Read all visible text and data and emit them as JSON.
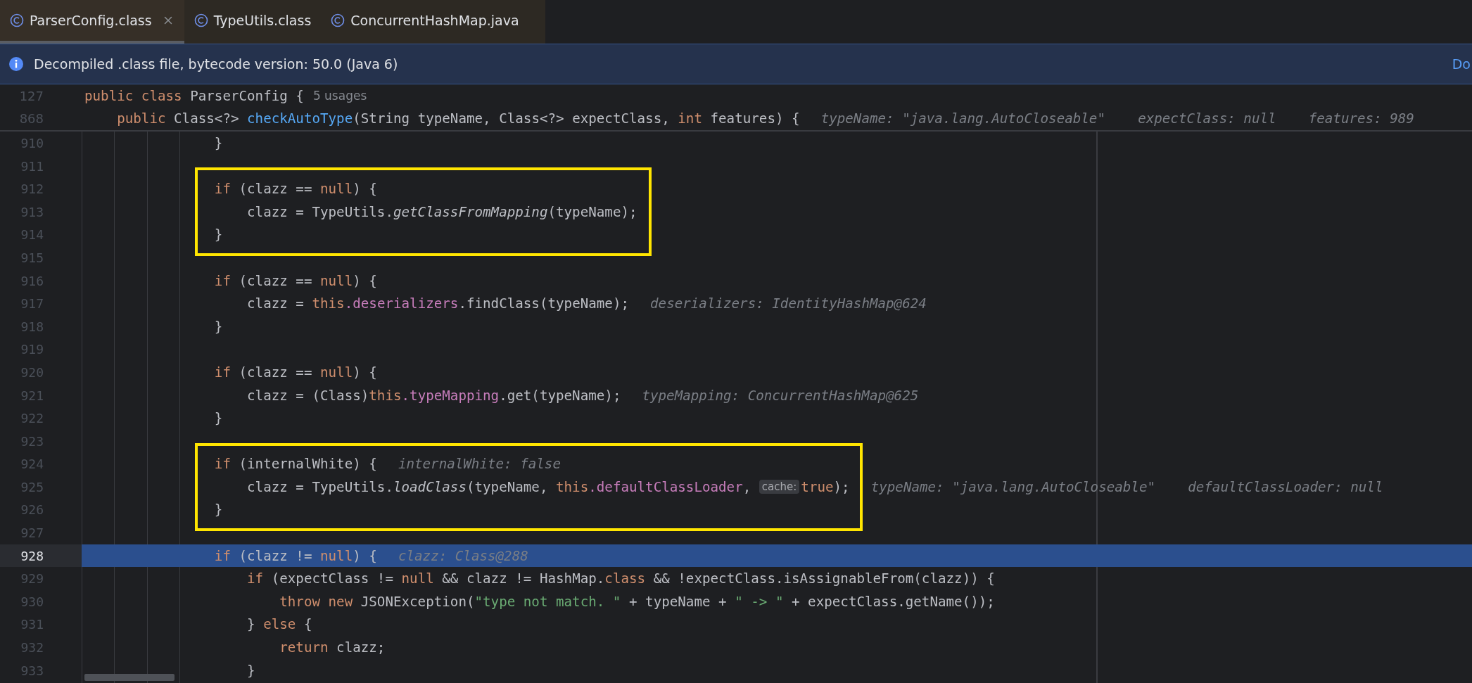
{
  "tabs": [
    {
      "label": "ParserConfig.class",
      "selected": true,
      "closable": true
    },
    {
      "label": "TypeUtils.class",
      "selected": false,
      "closable": false
    },
    {
      "label": "ConcurrentHashMap.java",
      "selected": false,
      "closable": false
    }
  ],
  "banner": {
    "text": "Decompiled .class file, bytecode version: 50.0 (Java 6)",
    "link": "Do"
  },
  "sticky_lines": [
    {
      "number": "127",
      "segments": [
        {
          "kind": "code",
          "parts": [
            {
              "kind": "kw",
              "text": "public class"
            },
            {
              "kind": "plain",
              "text": " ParserConfig {"
            }
          ]
        },
        {
          "kind": "usages",
          "text": "5 usages"
        }
      ]
    },
    {
      "number": "868",
      "segments": [
        {
          "kind": "code",
          "parts": [
            {
              "kind": "kw",
              "text": "    public"
            },
            {
              "kind": "plain",
              "text": " Class<?> "
            },
            {
              "kind": "decl",
              "text": "checkAutoType"
            },
            {
              "kind": "plain",
              "text": "(String typeName, Class<?> expectClass, "
            },
            {
              "kind": "kw",
              "text": "int"
            },
            {
              "kind": "plain",
              "text": " features) {"
            }
          ]
        },
        {
          "kind": "hint",
          "text": "typeName: \"java.lang.AutoCloseable\""
        },
        {
          "kind": "hint",
          "text": "expectClass: null"
        },
        {
          "kind": "hint",
          "text": "features: 989"
        }
      ]
    }
  ],
  "lines": [
    {
      "number": "910",
      "current": false,
      "boxed": false,
      "segments": [
        {
          "kind": "code",
          "parts": [
            {
              "kind": "plain",
              "text": "                }"
            }
          ]
        }
      ]
    },
    {
      "number": "911",
      "current": false,
      "boxed": false
    },
    {
      "number": "912",
      "current": false,
      "boxed": true,
      "segments": [
        {
          "kind": "code",
          "parts": [
            {
              "kind": "kw",
              "text": "                if"
            },
            {
              "kind": "plain",
              "text": " (clazz == "
            },
            {
              "kind": "kw",
              "text": "null"
            },
            {
              "kind": "plain",
              "text": ") {"
            }
          ]
        }
      ]
    },
    {
      "number": "913",
      "current": false,
      "boxed": true,
      "segments": [
        {
          "kind": "code",
          "parts": [
            {
              "kind": "plain",
              "text": "                    clazz = TypeUtils."
            },
            {
              "kind": "static",
              "text": "getClassFromMapping"
            },
            {
              "kind": "plain",
              "text": "(typeName);"
            }
          ]
        }
      ]
    },
    {
      "number": "914",
      "current": false,
      "boxed": true,
      "segments": [
        {
          "kind": "code",
          "parts": [
            {
              "kind": "plain",
              "text": "                }"
            }
          ]
        }
      ]
    },
    {
      "number": "915",
      "current": false,
      "boxed": false
    },
    {
      "number": "916",
      "current": false,
      "boxed": false,
      "segments": [
        {
          "kind": "code",
          "parts": [
            {
              "kind": "kw",
              "text": "                if"
            },
            {
              "kind": "plain",
              "text": " (clazz == "
            },
            {
              "kind": "kw",
              "text": "null"
            },
            {
              "kind": "plain",
              "text": ") {"
            }
          ]
        }
      ]
    },
    {
      "number": "917",
      "current": false,
      "boxed": false,
      "segments": [
        {
          "kind": "code",
          "parts": [
            {
              "kind": "plain",
              "text": "                    clazz = "
            },
            {
              "kind": "kw",
              "text": "this"
            },
            {
              "kind": "field",
              "text": ".deserializers"
            },
            {
              "kind": "plain",
              "text": ".findClass(typeName);"
            }
          ]
        },
        {
          "kind": "hint",
          "text": "deserializers: IdentityHashMap@624"
        }
      ]
    },
    {
      "number": "918",
      "current": false,
      "boxed": false,
      "segments": [
        {
          "kind": "code",
          "parts": [
            {
              "kind": "plain",
              "text": "                }"
            }
          ]
        }
      ]
    },
    {
      "number": "919",
      "current": false,
      "boxed": false
    },
    {
      "number": "920",
      "current": false,
      "boxed": false,
      "segments": [
        {
          "kind": "code",
          "parts": [
            {
              "kind": "kw",
              "text": "                if"
            },
            {
              "kind": "plain",
              "text": " (clazz == "
            },
            {
              "kind": "kw",
              "text": "null"
            },
            {
              "kind": "plain",
              "text": ") {"
            }
          ]
        }
      ]
    },
    {
      "number": "921",
      "current": false,
      "boxed": false,
      "segments": [
        {
          "kind": "code",
          "parts": [
            {
              "kind": "plain",
              "text": "                    clazz = (Class)"
            },
            {
              "kind": "kw",
              "text": "this"
            },
            {
              "kind": "field",
              "text": ".typeMapping"
            },
            {
              "kind": "plain",
              "text": ".get(typeName);"
            }
          ]
        },
        {
          "kind": "hint",
          "text": "typeMapping: ConcurrentHashMap@625"
        }
      ]
    },
    {
      "number": "922",
      "current": false,
      "boxed": false,
      "segments": [
        {
          "kind": "code",
          "parts": [
            {
              "kind": "plain",
              "text": "                }"
            }
          ]
        }
      ]
    },
    {
      "number": "923",
      "current": false,
      "boxed": false
    },
    {
      "number": "924",
      "current": false,
      "boxed": true,
      "segments": [
        {
          "kind": "code",
          "parts": [
            {
              "kind": "kw",
              "text": "                if"
            },
            {
              "kind": "plain",
              "text": " (internalWhite) {"
            }
          ]
        },
        {
          "kind": "hint",
          "text": "internalWhite: false"
        }
      ]
    },
    {
      "number": "925",
      "current": false,
      "boxed": true,
      "segments": [
        {
          "kind": "code",
          "parts": [
            {
              "kind": "plain",
              "text": "                    clazz = TypeUtils."
            },
            {
              "kind": "static",
              "text": "loadClass"
            },
            {
              "kind": "plain",
              "text": "(typeName, "
            },
            {
              "kind": "kw",
              "text": "this"
            },
            {
              "kind": "field",
              "text": ".defaultClassLoader"
            },
            {
              "kind": "plain",
              "text": ", "
            }
          ]
        },
        {
          "kind": "chip",
          "text": "cache:"
        },
        {
          "kind": "code",
          "parts": [
            {
              "kind": "kw",
              "text": "true"
            },
            {
              "kind": "plain",
              "text": ");"
            }
          ]
        },
        {
          "kind": "hint",
          "text": "typeName: \"java.lang.AutoCloseable\""
        },
        {
          "kind": "hint",
          "text": "defaultClassLoader: null"
        }
      ]
    },
    {
      "number": "926",
      "current": false,
      "boxed": true,
      "segments": [
        {
          "kind": "code",
          "parts": [
            {
              "kind": "plain",
              "text": "                }"
            }
          ]
        }
      ]
    },
    {
      "number": "927",
      "current": false,
      "boxed": false
    },
    {
      "number": "928",
      "current": true,
      "boxed": false,
      "segments": [
        {
          "kind": "code",
          "parts": [
            {
              "kind": "kw",
              "text": "                if"
            },
            {
              "kind": "plain",
              "text": " (clazz != "
            },
            {
              "kind": "kw",
              "text": "null"
            },
            {
              "kind": "plain",
              "text": ") {"
            }
          ]
        },
        {
          "kind": "hint",
          "text": "clazz: Class@288"
        }
      ]
    },
    {
      "number": "929",
      "current": false,
      "boxed": false,
      "segments": [
        {
          "kind": "code",
          "parts": [
            {
              "kind": "kw",
              "text": "                    if"
            },
            {
              "kind": "plain",
              "text": " (expectClass != "
            },
            {
              "kind": "kw",
              "text": "null"
            },
            {
              "kind": "plain",
              "text": " && clazz != HashMap."
            },
            {
              "kind": "kw",
              "text": "class"
            },
            {
              "kind": "plain",
              "text": " && !expectClass.isAssignableFrom(clazz)) {"
            }
          ]
        }
      ]
    },
    {
      "number": "930",
      "current": false,
      "boxed": false,
      "segments": [
        {
          "kind": "code",
          "parts": [
            {
              "kind": "kw",
              "text": "                        throw new"
            },
            {
              "kind": "plain",
              "text": " JSONException("
            },
            {
              "kind": "string",
              "text": "\"type not match. \""
            },
            {
              "kind": "plain",
              "text": " + typeName + "
            },
            {
              "kind": "string",
              "text": "\" -> \""
            },
            {
              "kind": "plain",
              "text": " + expectClass.getName());"
            }
          ]
        }
      ]
    },
    {
      "number": "931",
      "current": false,
      "boxed": false,
      "segments": [
        {
          "kind": "code",
          "parts": [
            {
              "kind": "plain",
              "text": "                    } "
            },
            {
              "kind": "kw",
              "text": "else"
            },
            {
              "kind": "plain",
              "text": " {"
            }
          ]
        }
      ]
    },
    {
      "number": "932",
      "current": false,
      "boxed": false,
      "segments": [
        {
          "kind": "code",
          "parts": [
            {
              "kind": "kw",
              "text": "                        return"
            },
            {
              "kind": "plain",
              "text": " clazz;"
            }
          ]
        }
      ]
    },
    {
      "number": "933",
      "current": false,
      "boxed": false,
      "segments": [
        {
          "kind": "code",
          "parts": [
            {
              "kind": "plain",
              "text": "                    }"
            }
          ]
        }
      ]
    }
  ]
}
